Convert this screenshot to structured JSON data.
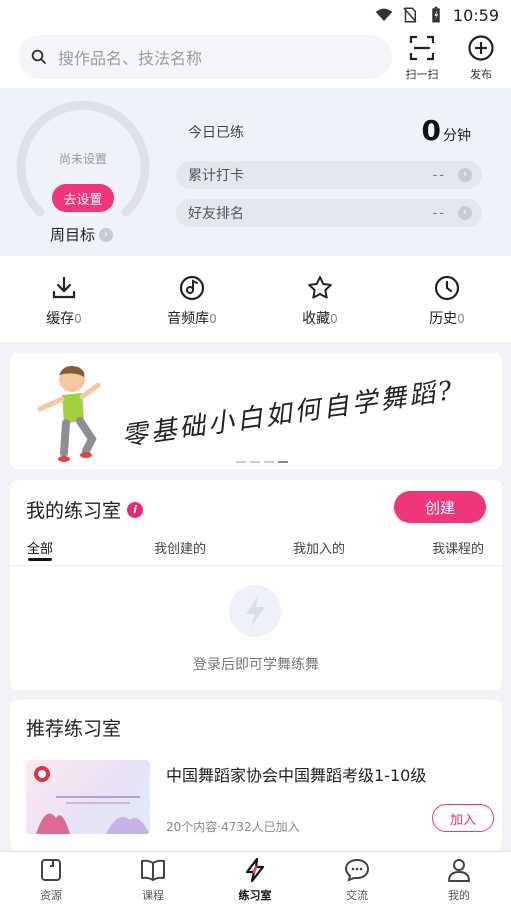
{
  "status_bar": {
    "time": "10:59"
  },
  "search": {
    "placeholder": "搜作品名、技法名称"
  },
  "header": {
    "scan_label": "扫一扫",
    "publish_label": "发布"
  },
  "goal": {
    "not_set": "尚未设置",
    "set_button": "去设置",
    "weekly_goal": "周目标",
    "today_label": "今日已练",
    "today_value": "0",
    "today_unit": "分钟",
    "checkin_label": "累计打卡",
    "checkin_value": "--",
    "rank_label": "好友排名",
    "rank_value": "--"
  },
  "quick_actions": [
    {
      "label": "缓存",
      "count": "0",
      "icon": "download-icon"
    },
    {
      "label": "音频库",
      "count": "0",
      "icon": "music-disc-icon"
    },
    {
      "label": "收藏",
      "count": "0",
      "icon": "star-icon"
    },
    {
      "label": "历史",
      "count": "0",
      "icon": "clock-icon"
    }
  ],
  "banner": {
    "title": "零基础小白如何自学舞蹈?",
    "page_count": 4,
    "active_page": 4
  },
  "practice": {
    "title": "我的练习室",
    "create_button": "创建",
    "tabs": [
      "全部",
      "我创建的",
      "我加入的",
      "我课程的"
    ],
    "active_tab": 0,
    "empty_text": "登录后即可学舞练舞"
  },
  "recommended": {
    "title": "推荐练习室",
    "items": [
      {
        "title": "中国舞蹈家协会中国舞蹈考级1-10级",
        "meta": "20个内容·4732人已加入",
        "join_button": "加入"
      }
    ]
  },
  "bottom_nav": [
    {
      "label": "资源",
      "icon": "resource-icon"
    },
    {
      "label": "课程",
      "icon": "book-icon"
    },
    {
      "label": "练习室",
      "icon": "lightning-icon",
      "active": true
    },
    {
      "label": "交流",
      "icon": "chat-icon"
    },
    {
      "label": "我的",
      "icon": "user-icon"
    }
  ]
}
